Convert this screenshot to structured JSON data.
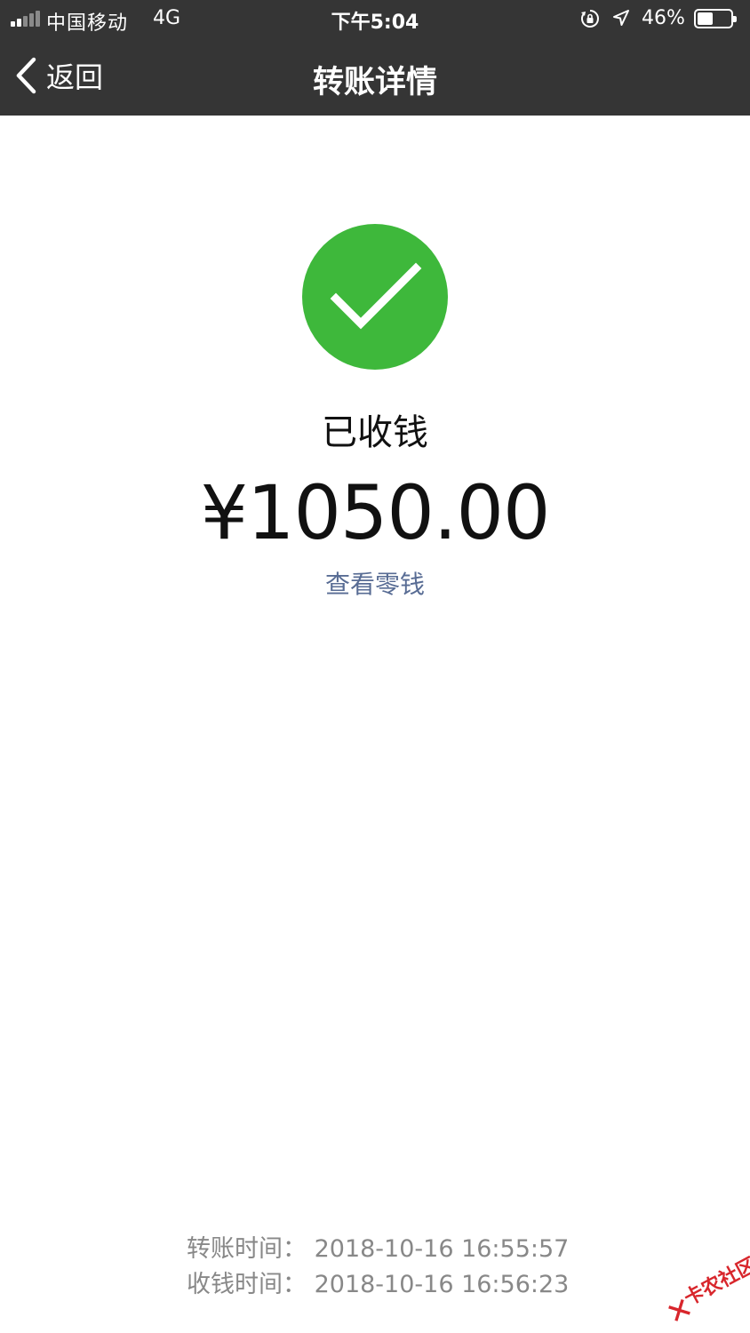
{
  "status_bar": {
    "carrier": "中国移动",
    "network": "4G",
    "time": "下午5:04",
    "battery_percent": "46%",
    "battery_level": 0.46
  },
  "nav": {
    "back_label": "返回",
    "title": "转账详情"
  },
  "transfer": {
    "status": "已收钱",
    "amount": "¥1050.00",
    "view_change_link": "查看零钱",
    "transfer_time": "转账时间：  2018-10-16 16:55:57",
    "received_time": "收钱时间：  2018-10-16 16:56:23"
  },
  "watermark": {
    "text": "卡农社区"
  },
  "colors": {
    "nav_background": "#353535",
    "success_green": "#3eb83b",
    "link_blue": "#586c94",
    "meta_gray": "#888888"
  }
}
